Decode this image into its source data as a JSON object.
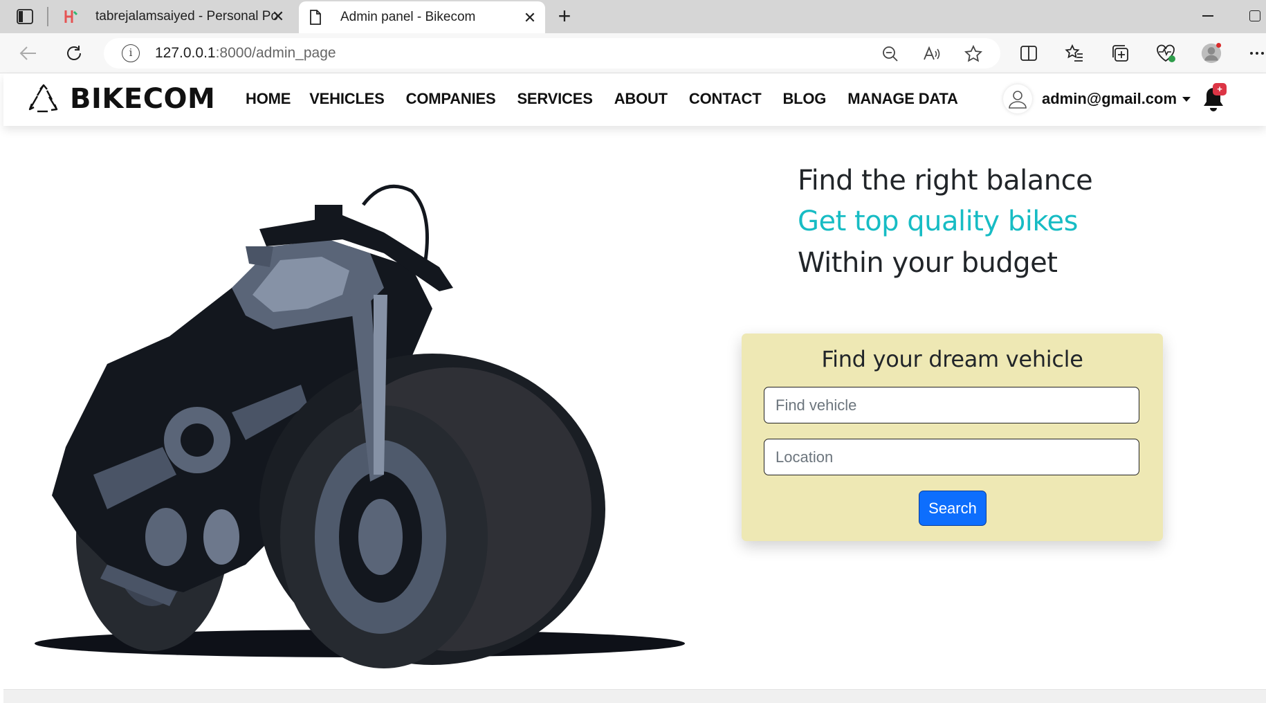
{
  "browser": {
    "tabs": [
      {
        "title": "tabrejalamsaiyed - Personal Portfolio",
        "active": false
      },
      {
        "title": "Admin panel - Bikecom",
        "active": true
      }
    ],
    "url_host": "127.0.0.1",
    "url_rest": ":8000/admin_page"
  },
  "navbar": {
    "brand": "BIKECOM",
    "links": [
      "HOME",
      "VEHICLES",
      "COMPANIES",
      "SERVICES",
      "ABOUT",
      "CONTACT",
      "BLOG",
      "MANAGE DATA"
    ],
    "user_email": "admin@gmail.com",
    "notification_badge": "+"
  },
  "hero": {
    "line1": "Find the right balance",
    "line2": "Get top quality bikes",
    "line3": "Within your budget",
    "accent_color": "#17bcc4"
  },
  "search_card": {
    "title": "Find your dream vehicle",
    "vehicle_placeholder": "Find vehicle",
    "location_placeholder": "Location",
    "button_label": "Search",
    "card_color": "#eee8b4",
    "button_color": "#0d6efd"
  }
}
